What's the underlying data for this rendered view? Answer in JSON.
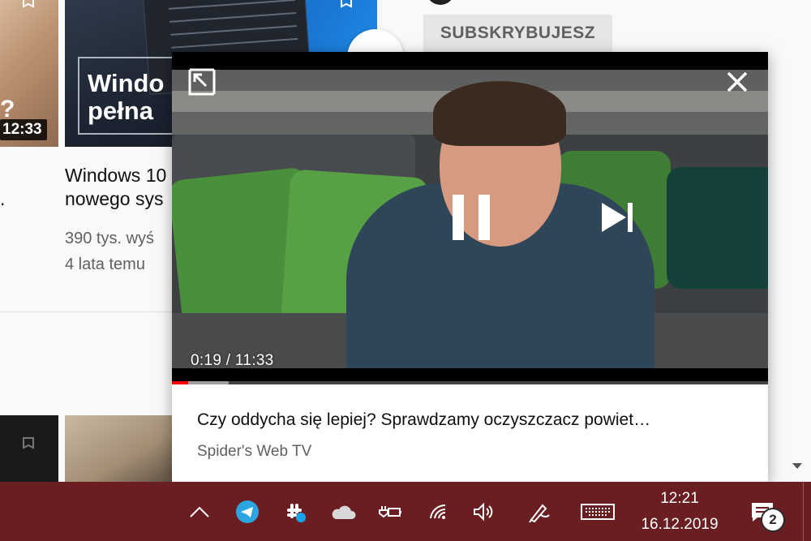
{
  "background": {
    "video_left": {
      "duration": "12:33",
      "title_fragment": "."
    },
    "video_mid": {
      "thumbnail_text": "Windo\npełna",
      "title": "Windows 10\nnowego sys",
      "views": "390 tys. wyś",
      "age": "4 lata temu"
    },
    "subscribe_label": "SUBSKRYBUJESZ"
  },
  "miniplayer": {
    "timecode": "0:19 / 11:33",
    "progress_played": 0.027,
    "progress_buffered": 0.095,
    "title": "Czy oddycha się lepiej? Sprawdzamy oczyszczacz powiet…",
    "channel": "Spider's Web TV",
    "icons": [
      "expand-icon",
      "close-icon",
      "pause-icon",
      "next-icon"
    ]
  },
  "taskbar": {
    "time": "12:21",
    "date": "16.12.2019",
    "notification_count": "2",
    "icons": [
      "chevron-up-icon",
      "telegram-icon",
      "slack-icon",
      "onedrive-icon",
      "battery-plug-icon",
      "wifi-icon",
      "volume-icon",
      "pen-icon",
      "keyboard-icon",
      "action-center-icon"
    ],
    "accent": "#6b1e21"
  }
}
